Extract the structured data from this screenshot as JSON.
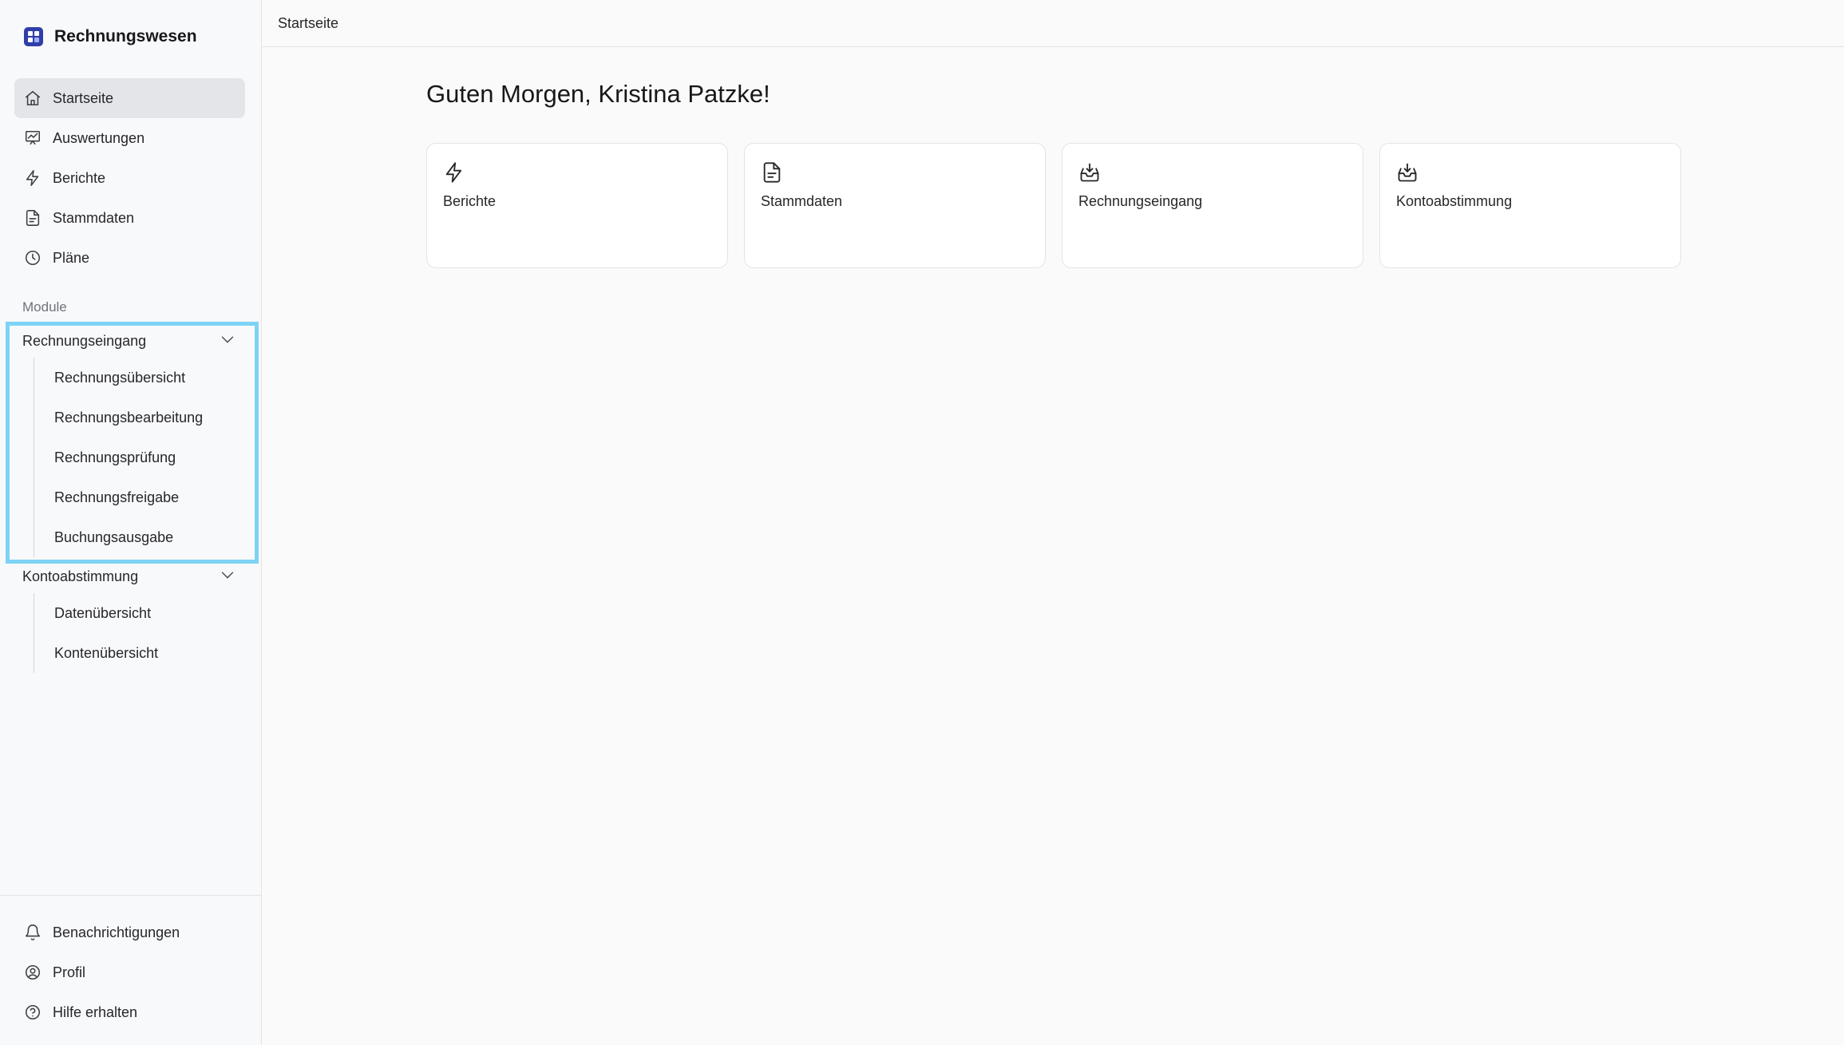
{
  "brand": {
    "title": "Rechnungswesen",
    "icon": "app-logo-icon"
  },
  "nav": {
    "items": [
      {
        "label": "Startseite",
        "icon": "home-icon",
        "active": true
      },
      {
        "label": "Auswertungen",
        "icon": "chart-board-icon"
      },
      {
        "label": "Berichte",
        "icon": "lightning-icon"
      },
      {
        "label": "Stammdaten",
        "icon": "document-icon"
      },
      {
        "label": "Pläne",
        "icon": "clock-icon"
      }
    ]
  },
  "modules": {
    "section_label": "Module",
    "groups": [
      {
        "label": "Rechnungseingang",
        "expanded": true,
        "items": [
          "Rechnungsübersicht",
          "Rechnungsbearbeitung",
          "Rechnungsprüfung",
          "Rechnungsfreigabe",
          "Buchungsausgabe"
        ]
      },
      {
        "label": "Kontoabstimmung",
        "expanded": true,
        "items": [
          "Datenübersicht",
          "Kontenübersicht"
        ]
      }
    ]
  },
  "footer_nav": {
    "items": [
      {
        "label": "Benachrichtigungen",
        "icon": "bell-icon"
      },
      {
        "label": "Profil",
        "icon": "user-circle-icon"
      },
      {
        "label": "Hilfe erhalten",
        "icon": "help-circle-icon"
      }
    ]
  },
  "topbar": {
    "breadcrumb": "Startseite"
  },
  "main": {
    "greeting": "Guten Morgen, Kristina Patzke!",
    "cards": [
      {
        "label": "Berichte",
        "icon": "lightning-icon"
      },
      {
        "label": "Stammdaten",
        "icon": "document-icon"
      },
      {
        "label": "Rechnungseingang",
        "icon": "inbox-download-icon"
      },
      {
        "label": "Kontoabstimmung",
        "icon": "inbox-download-icon"
      }
    ]
  },
  "colors": {
    "highlight_border": "#7dd3f5",
    "brand_logo": "#2f3ea8",
    "active_nav_bg": "#e4e5e9"
  }
}
